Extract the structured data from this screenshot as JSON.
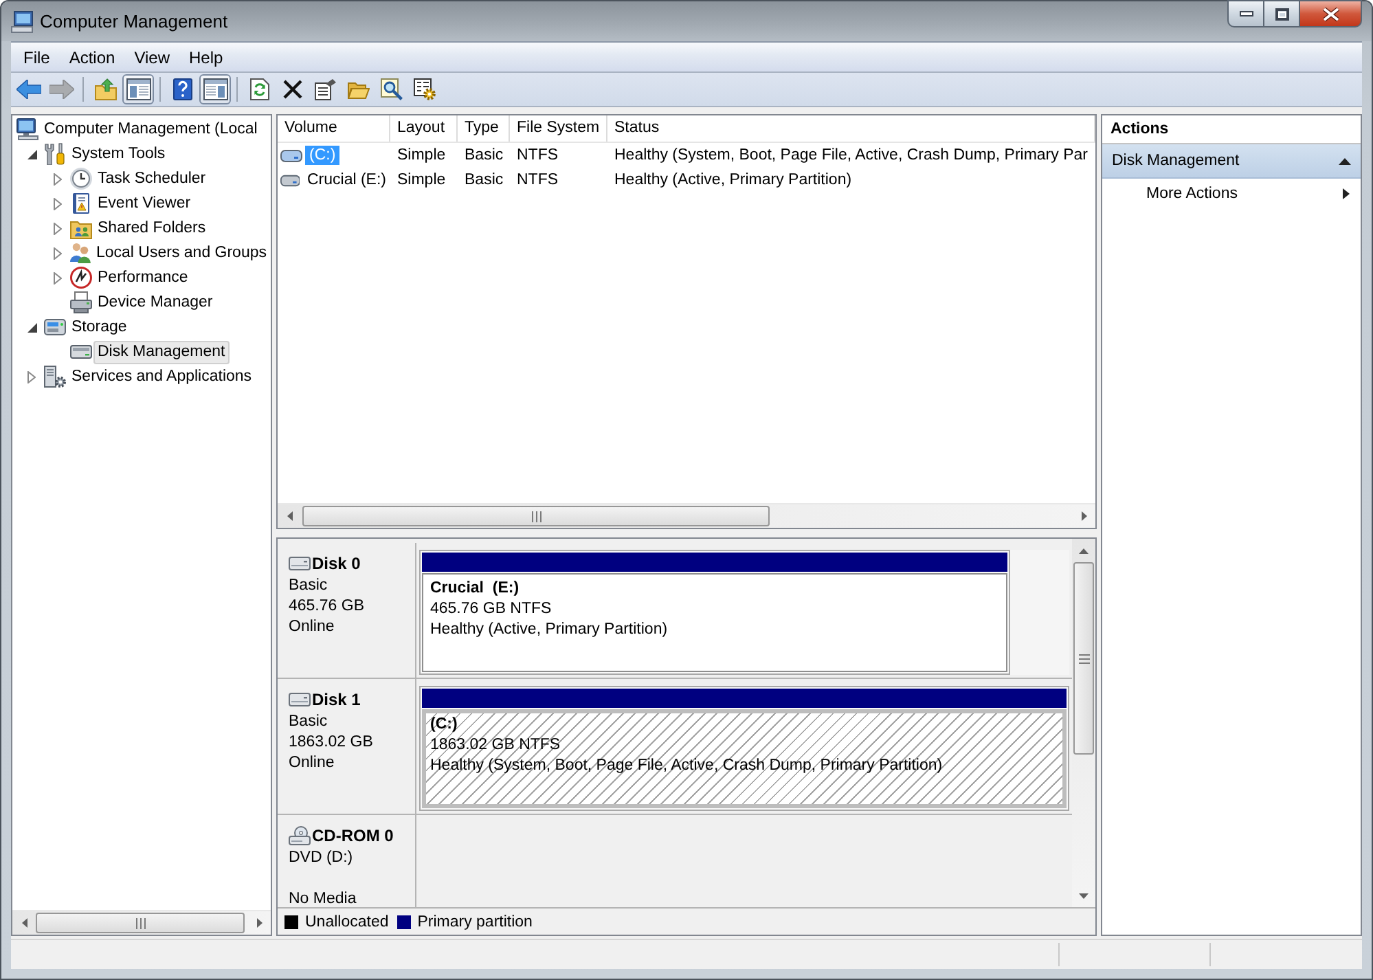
{
  "window": {
    "title": "Computer Management"
  },
  "menu": [
    "File",
    "Action",
    "View",
    "Help"
  ],
  "toolbar": [
    {
      "buttons": [
        {
          "disabled": false,
          "pressed": false
        },
        {
          "disabled": true,
          "pressed": false
        }
      ]
    },
    {
      "buttons": [
        {
          "disabled": false,
          "pressed": false
        },
        {
          "disabled": false,
          "pressed": true
        }
      ]
    },
    {
      "buttons": [
        {
          "disabled": false,
          "pressed": false
        },
        {
          "disabled": false,
          "pressed": true
        }
      ]
    },
    {
      "buttons": [
        {
          "disabled": false,
          "pressed": false
        },
        {
          "disabled": false,
          "pressed": false
        },
        {
          "disabled": false,
          "pressed": false
        },
        {
          "disabled": false,
          "pressed": false
        },
        {
          "disabled": false,
          "pressed": false
        },
        {
          "disabled": false,
          "pressed": false
        }
      ]
    }
  ],
  "tree": [
    {
      "label": "Computer Management (Local",
      "selected": false,
      "children": [
        {
          "label": "System Tools",
          "expanded": true,
          "selected": false,
          "children": [
            {
              "label": "Task Scheduler",
              "expanded": false,
              "selected": false
            },
            {
              "label": "Event Viewer",
              "expanded": false,
              "selected": false
            },
            {
              "label": "Shared Folders",
              "expanded": false,
              "selected": false
            },
            {
              "label": "Local Users and Groups",
              "expanded": false,
              "selected": false
            },
            {
              "label": "Performance",
              "expanded": false,
              "selected": false
            },
            {
              "label": "Device Manager",
              "selected": false
            }
          ]
        },
        {
          "label": "Storage",
          "expanded": true,
          "selected": false,
          "children": [
            {
              "label": "Disk Management",
              "selected": true
            }
          ]
        },
        {
          "label": "Services and Applications",
          "expanded": false,
          "selected": false
        }
      ]
    }
  ],
  "volumes": {
    "columns": [
      "Volume",
      "Layout",
      "Type",
      "File System",
      "Status"
    ],
    "rows": [
      {
        "cells": [
          "(C:)",
          "Simple",
          "Basic",
          "NTFS",
          "Healthy (System, Boot, Page File, Active, Crash Dump, Primary Par"
        ],
        "selected": true
      },
      {
        "cells": [
          "Crucial (E:)",
          "Simple",
          "Basic",
          "NTFS",
          "Healthy (Active, Primary Partition)"
        ],
        "selected": false
      }
    ]
  },
  "disks": [
    {
      "kind": "disk",
      "name": "Disk 0",
      "type": "Basic",
      "size": "465.76 GB",
      "status": "Online",
      "partitions": [
        {
          "kind": "primary",
          "title": "Crucial  (E:)",
          "size": "465.76 GB NTFS",
          "status": "Healthy (Active, Primary Partition)",
          "selected": false,
          "level": 0.91
        }
      ]
    },
    {
      "kind": "disk",
      "name": "Disk 1",
      "type": "Basic",
      "size": "1863.02 GB",
      "status": "Online",
      "partitions": [
        {
          "kind": "primary",
          "title": "(C:)",
          "size": "1863.02 GB NTFS",
          "status": "Healthy (System, Boot, Page File, Active, Crash Dump, Primary Partition)",
          "selected": true,
          "level": 1
        }
      ]
    },
    {
      "kind": "cdrom",
      "name": "CD-ROM 0",
      "type": "DVD (D:)",
      "status": "No Media"
    }
  ],
  "legend": [
    {
      "kind": "unallocated",
      "label": "Unallocated",
      "color": "#000000"
    },
    {
      "kind": "primary",
      "label": "Primary partition",
      "color": "#000080"
    }
  ],
  "actions": {
    "title": "Actions",
    "sections": [
      {
        "title": "Disk Management",
        "expanded": true,
        "items": [
          {
            "label": "More Actions",
            "submenu": true
          }
        ]
      }
    ]
  }
}
